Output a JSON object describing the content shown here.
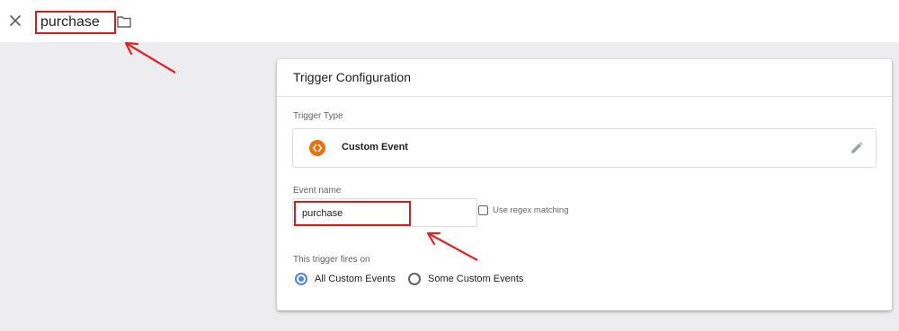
{
  "header": {
    "close_icon": "close-icon",
    "trigger_name": "purchase",
    "folder_icon": "folder-icon"
  },
  "card": {
    "title": "Trigger Configuration",
    "trigger_type": {
      "label": "Trigger Type",
      "value": "Custom Event",
      "icon": "code-brackets-icon",
      "icon_color": "#e8710a",
      "edit_icon": "pencil-icon"
    },
    "event_name": {
      "label": "Event name",
      "value": "purchase",
      "regex_label": "Use regex matching",
      "regex_checked": false
    },
    "fires_on": {
      "label": "This trigger fires on",
      "options": [
        {
          "label": "All Custom Events",
          "selected": true
        },
        {
          "label": "Some Custom Events",
          "selected": false
        }
      ]
    }
  },
  "annotations": {
    "highlight_color": "#cc1f1f",
    "arrow_color": "#e32222"
  },
  "colors": {
    "background": "#ededef",
    "radio_selected": "#4a86e8"
  }
}
